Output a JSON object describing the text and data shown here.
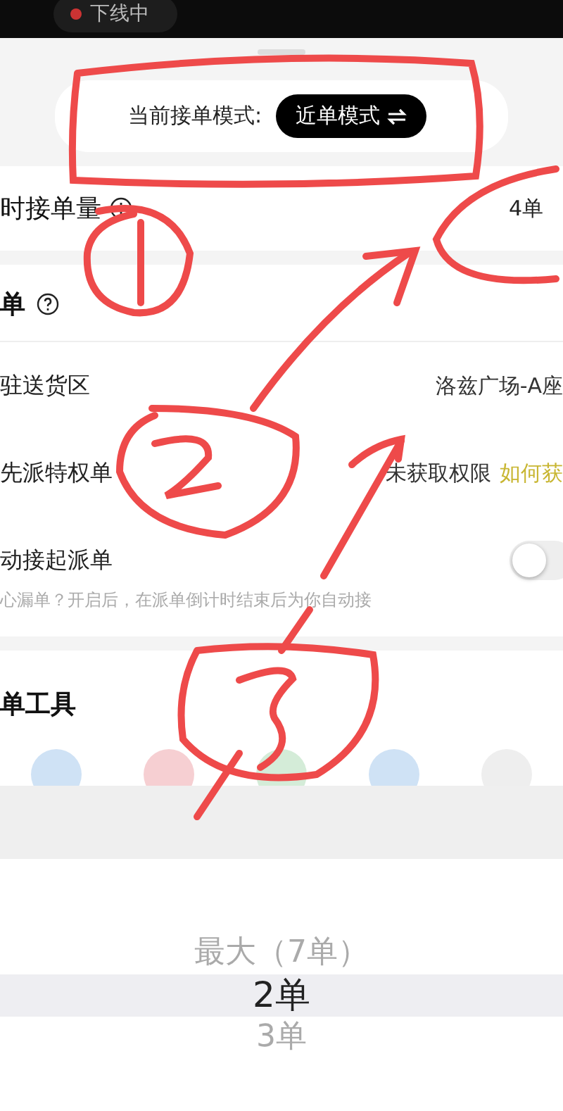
{
  "top_bar": {
    "status": "下线中"
  },
  "mode_card": {
    "label": "当前接单模式:",
    "mode": "近单模式"
  },
  "capacity": {
    "label": "时接单量",
    "value": "4单"
  },
  "dispatch": {
    "title": "单",
    "rows": [
      {
        "kind": "value",
        "label": "驻送货区",
        "value": "洛兹广场-A座"
      },
      {
        "kind": "link",
        "label": "先派特权单",
        "value": "未获取权限",
        "link": "如何获"
      },
      {
        "kind": "toggle",
        "label": "动接起派单",
        "hint": "心漏单？开启后，在派单倒计时结束后为你自动接",
        "on": false
      }
    ]
  },
  "tools": {
    "title": "单工具"
  },
  "picker": {
    "options": [
      {
        "label": "最大（7单）",
        "selected": false
      },
      {
        "label": "2单",
        "selected": true
      },
      {
        "label": "3单",
        "selected": false
      }
    ]
  }
}
